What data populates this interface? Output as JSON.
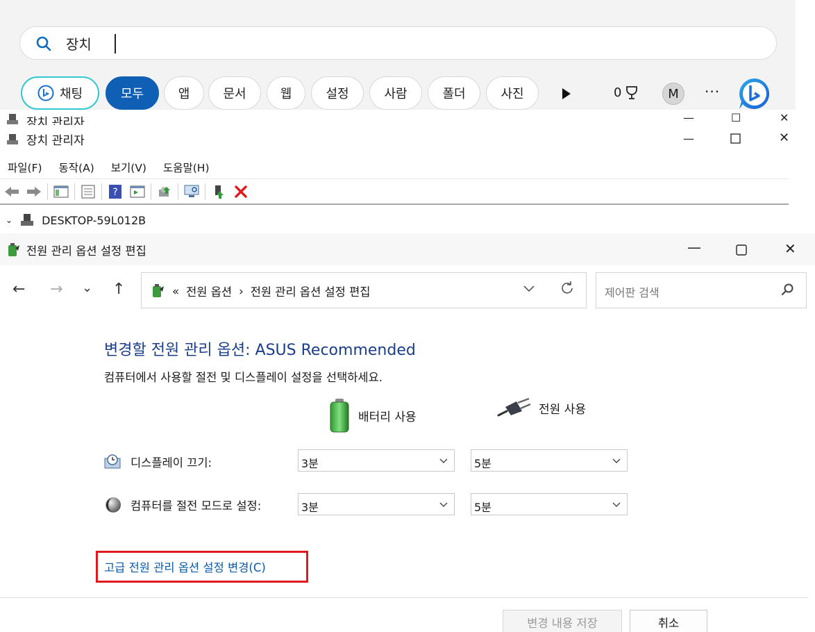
{
  "search": {
    "query": "장치",
    "chips": [
      "채팅",
      "모두",
      "앱",
      "문서",
      "웹",
      "설정",
      "사람",
      "폴더",
      "사진"
    ],
    "points": "0",
    "avatar_letter": "M",
    "more": "···"
  },
  "device_manager": {
    "title": "장치 관리자",
    "menu": [
      "파일(F)",
      "동작(A)",
      "보기(V)",
      "도움말(H)"
    ],
    "tree_root": "DESKTOP-59L012B"
  },
  "power_window": {
    "title": "전원 관리 옵션 설정 편집",
    "breadcrumb_prefix": "«",
    "breadcrumb": [
      "전원 옵션",
      "전원 관리 옵션 설정 편집"
    ],
    "breadcrumb_sep": "›",
    "search_placeholder": "제어판 검색",
    "heading": "변경할 전원 관리 옵션: ASUS Recommended",
    "subtitle": "컴퓨터에서 사용할 절전 및 디스플레이 설정을 선택하세요.",
    "col_battery": "배터리 사용",
    "col_plugged": "전원 사용",
    "rows": [
      {
        "label": "디스플레이 끄기:",
        "battery": "3분",
        "plugged": "5분"
      },
      {
        "label": "컴퓨터를 절전 모드로 설정:",
        "battery": "3분",
        "plugged": "5분"
      }
    ],
    "advanced_link": "고급 전원 관리 옵션 설정 변경(C)",
    "save_button": "변경 내용 저장",
    "cancel_button": "취소"
  },
  "colors": {
    "accent": "#0f5fb5",
    "chat_border": "#33c7cf",
    "heading": "#1a3e8a",
    "link": "#0b5aa8",
    "highlight": "#e0191f"
  }
}
